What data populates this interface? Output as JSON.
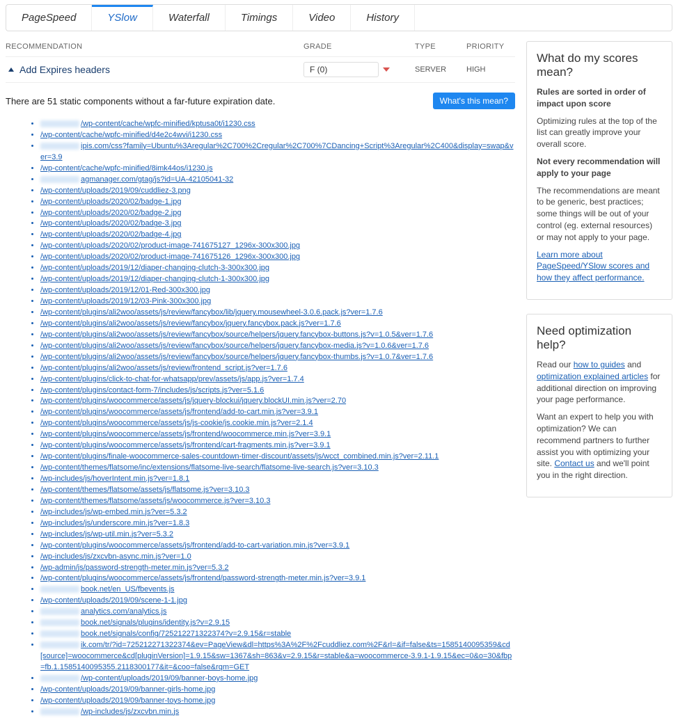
{
  "tabs": [
    {
      "id": "pagespeed",
      "label": "PageSpeed"
    },
    {
      "id": "yslow",
      "label": "YSlow"
    },
    {
      "id": "waterfall",
      "label": "Waterfall"
    },
    {
      "id": "timings",
      "label": "Timings"
    },
    {
      "id": "video",
      "label": "Video"
    },
    {
      "id": "history",
      "label": "History"
    }
  ],
  "active_tab": "yslow",
  "columns": {
    "recommendation": "RECOMMENDATION",
    "grade": "GRADE",
    "type": "TYPE",
    "priority": "PRIORITY"
  },
  "rule": {
    "title": "Add Expires headers",
    "grade": "F (0)",
    "type": "SERVER",
    "priority": "HIGH",
    "description": "There are 51 static components without a far-future expiration date.",
    "mean_label": "What's this mean?"
  },
  "files": [
    "/wp-content/cache/wpfc-minified/kptusa0t/i1230.css",
    "/wp-content/cache/wpfc-minified/d4e2c4wvi/i1230.css",
    "ipis.com/css?family=Ubuntu%3Aregular%2C700%2Cregular%2C700%7CDancing+Script%3Aregular%2C400&display=swap&ver=3.9",
    "/wp-content/cache/wpfc-minified/8imk44os/i1230.js",
    "agmanager.com/gtag/js?id=UA-42105041-32",
    "/wp-content/uploads/2019/09/cuddliez-3.png",
    "/wp-content/uploads/2020/02/badge-1.jpg",
    "/wp-content/uploads/2020/02/badge-2.jpg",
    "/wp-content/uploads/2020/02/badge-3.jpg",
    "/wp-content/uploads/2020/02/badge-4.jpg",
    "/wp-content/uploads/2020/02/product-image-741675127_1296x-300x300.jpg",
    "/wp-content/uploads/2020/02/product-image-741675126_1296x-300x300.jpg",
    "/wp-content/uploads/2019/12/diaper-changing-clutch-3-300x300.jpg",
    "/wp-content/uploads/2019/12/diaper-changing-clutch-1-300x300.jpg",
    "/wp-content/uploads/2019/12/01-Red-300x300.jpg",
    "/wp-content/uploads/2019/12/03-Pink-300x300.jpg",
    "/wp-content/plugins/ali2woo/assets/js/review/fancybox/lib/jquery.mousewheel-3.0.6.pack.js?ver=1.7.6",
    "/wp-content/plugins/ali2woo/assets/js/review/fancybox/jquery.fancybox.pack.js?ver=1.7.6",
    "/wp-content/plugins/ali2woo/assets/js/review/fancybox/source/helpers/jquery.fancybox-buttons.js?v=1.0.5&ver=1.7.6",
    "/wp-content/plugins/ali2woo/assets/js/review/fancybox/source/helpers/jquery.fancybox-media.js?v=1.0.6&ver=1.7.6",
    "/wp-content/plugins/ali2woo/assets/js/review/fancybox/source/helpers/jquery.fancybox-thumbs.js?v=1.0.7&ver=1.7.6",
    "/wp-content/plugins/ali2woo/assets/js/review/frontend_script.js?ver=1.7.6",
    "/wp-content/plugins/click-to-chat-for-whatsapp/prev/assets/js/app.js?ver=1.7.4",
    "/wp-content/plugins/contact-form-7/includes/js/scripts.js?ver=5.1.6",
    "/wp-content/plugins/woocommerce/assets/js/jquery-blockui/jquery.blockUI.min.js?ver=2.70",
    "/wp-content/plugins/woocommerce/assets/js/frontend/add-to-cart.min.js?ver=3.9.1",
    "/wp-content/plugins/woocommerce/assets/js/js-cookie/js.cookie.min.js?ver=2.1.4",
    "/wp-content/plugins/woocommerce/assets/js/frontend/woocommerce.min.js?ver=3.9.1",
    "/wp-content/plugins/woocommerce/assets/js/frontend/cart-fragments.min.js?ver=3.9.1",
    "/wp-content/plugins/finale-woocommerce-sales-countdown-timer-discount/assets/js/wcct_combined.min.js?ver=2.11.1",
    "/wp-content/themes/flatsome/inc/extensions/flatsome-live-search/flatsome-live-search.js?ver=3.10.3",
    "/wp-includes/js/hoverIntent.min.js?ver=1.8.1",
    "/wp-content/themes/flatsome/assets/js/flatsome.js?ver=3.10.3",
    "/wp-content/themes/flatsome/assets/js/woocommerce.js?ver=3.10.3",
    "/wp-includes/js/wp-embed.min.js?ver=5.3.2",
    "/wp-includes/js/underscore.min.js?ver=1.8.3",
    "/wp-includes/js/wp-util.min.js?ver=5.3.2",
    "/wp-content/plugins/woocommerce/assets/js/frontend/add-to-cart-variation.min.js?ver=3.9.1",
    "/wp-includes/js/zxcvbn-async.min.js?ver=1.0",
    "/wp-admin/js/password-strength-meter.min.js?ver=5.3.2",
    "/wp-content/plugins/woocommerce/assets/js/frontend/password-strength-meter.min.js?ver=3.9.1",
    "book.net/en_US/fbevents.js",
    "/wp-content/uploads/2019/09/scene-1-1.jpg",
    "analytics.com/analytics.js",
    "book.net/signals/plugins/identity.js?v=2.9.15",
    "book.net/signals/config/725212271322374?v=2.9.15&r=stable",
    "ik.com/tr/?id=725212271322374&ev=PageView&dl=https%3A%2F%2Fcuddliez.com%2F&rl=&if=false&ts=1585140095359&cd[source]=woocommerce&cd[pluginVersion]=1.9.15&sw=1367&sh=863&v=2.9.15&r=stable&a=woocommerce-3.9.1-1.9.15&ec=0&o=30&fbp=fb.1.1585140095355.2118300177&it=&coo=false&rqm=GET",
    "/wp-content/uploads/2019/09/banner-boys-home.jpg",
    "/wp-content/uploads/2019/09/banner-girls-home.jpg",
    "/wp-content/uploads/2019/09/banner-toys-home.jpg",
    "/wp-includes/js/zxcvbn.min.js"
  ],
  "scores_panel": {
    "title": "What do my scores mean?",
    "h1": "Rules are sorted in order of impact upon score",
    "p1": "Optimizing rules at the top of the list can greatly improve your overall score.",
    "h2": "Not every recommendation will apply to your page",
    "p2": "The recommendations are meant to be generic, best practices; some things will be out of your control (eg. external resources) or may not apply to your page.",
    "link": "Learn more about PageSpeed/YSlow scores and how they affect performance."
  },
  "help_panel": {
    "title": "Need optimization help?",
    "lead": "Read our ",
    "link1": "how to guides",
    "mid": " and ",
    "link2": "optimization explained articles",
    "rest": " for additional direction on improving your page performance.",
    "p2a": "Want an expert to help you with optimization? We can recommend partners to further assist you with optimizing your site. ",
    "contact": "Contact us",
    "p2b": " and we'll point you in the right direction."
  }
}
